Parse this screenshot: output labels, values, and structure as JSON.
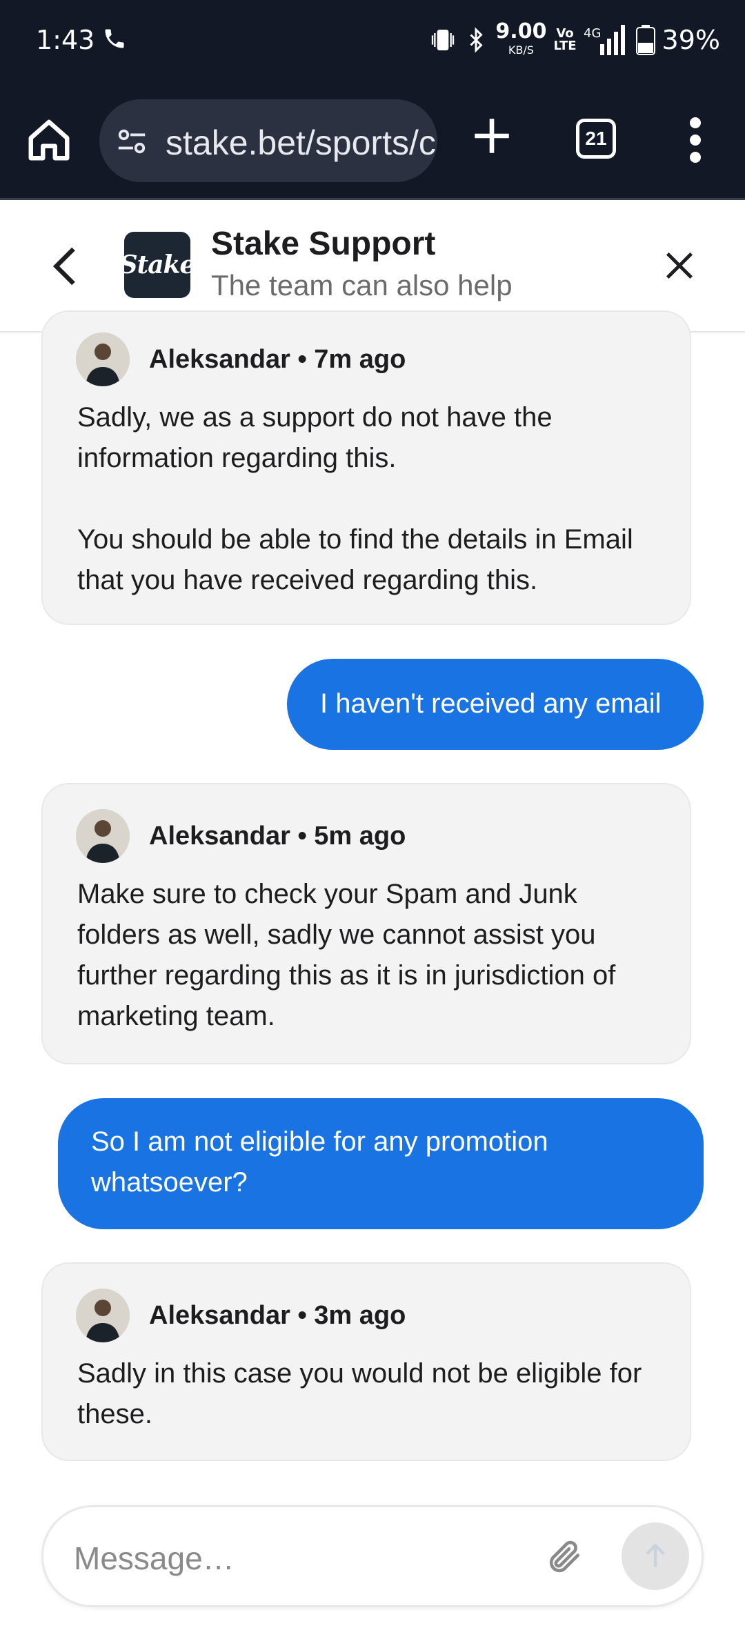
{
  "status_bar": {
    "time": "1:43",
    "net_speed": "9.00",
    "net_unit": "KB/S",
    "volte_top": "Vo",
    "volte_bottom": "LTE",
    "network": "4G",
    "battery": "39%"
  },
  "browser": {
    "url": "stake.bet/sports/c",
    "tab_count": "21"
  },
  "chat_header": {
    "logo_text": "Stake",
    "title": "Stake Support",
    "subtitle": "The team can also help"
  },
  "messages": [
    {
      "type": "agent",
      "author": "Aleksandar • 7m ago",
      "text": "Sadly, we as a support do not have the information regarding this.\n\nYou should be able to find the details in Email that you have received regarding this."
    },
    {
      "type": "user",
      "text": "I haven't received any email"
    },
    {
      "type": "agent",
      "author": "Aleksandar • 5m ago",
      "text": "Make sure to check your Spam and Junk folders as well, sadly we cannot assist you further regarding this as it is in jurisdiction of marketing team."
    },
    {
      "type": "user",
      "text": "So I am not eligible for any promotion whatsoever?"
    },
    {
      "type": "agent",
      "author": "Aleksandar • 3m ago",
      "text": "Sadly in this case you would not be eligible for these."
    }
  ],
  "composer": {
    "placeholder": "Message…"
  },
  "colors": {
    "status_bg": "#121826",
    "user_bubble": "#1a73e3",
    "agent_bubble": "#f3f3f3"
  }
}
